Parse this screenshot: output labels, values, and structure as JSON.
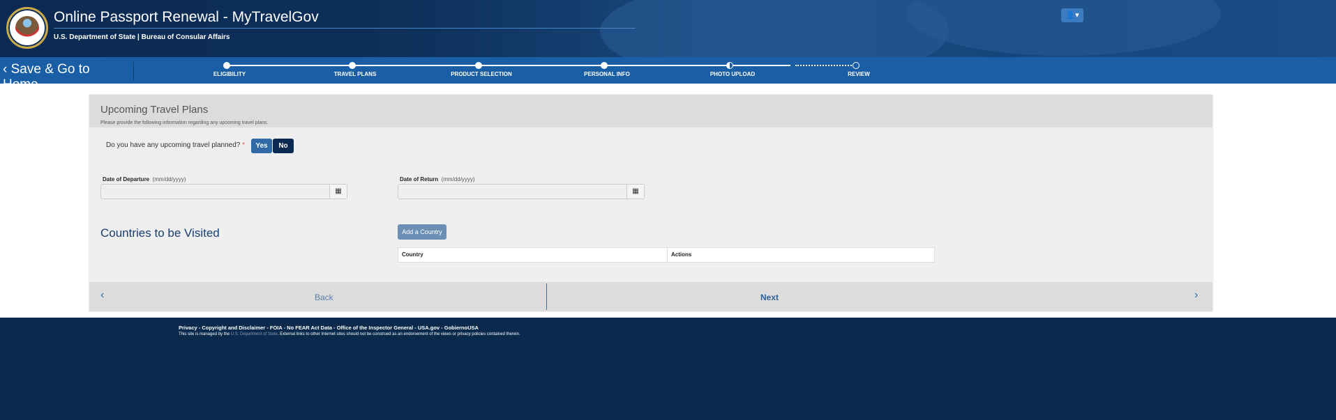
{
  "header": {
    "title": "Online Passport Renewal - MyTravelGov",
    "subtitle": "U.S. Department of State | Bureau of Consular Affairs",
    "user_menu": "👤▾"
  },
  "nav": {
    "save_home": "‹  Save & Go to Home",
    "steps": [
      {
        "label": "ELIGIBILITY",
        "state": "complete"
      },
      {
        "label": "TRAVEL PLANS",
        "state": "complete"
      },
      {
        "label": "PRODUCT SELECTION",
        "state": "complete"
      },
      {
        "label": "PERSONAL INFO",
        "state": "complete"
      },
      {
        "label": "PHOTO UPLOAD",
        "state": "current"
      },
      {
        "label": "REVIEW",
        "state": "pending"
      }
    ]
  },
  "form": {
    "title": "Upcoming Travel Plans",
    "description": "Please provide the following information regarding any upcoming travel plans.",
    "question": "Do you have any upcoming travel planned?",
    "required_mark": "*",
    "yes": "Yes",
    "no": "No",
    "departure_label": "Date of Departure",
    "return_label": "Date of Return",
    "date_hint": "(mm/dd/yyyy)",
    "departure_value": "",
    "return_value": "",
    "countries_title": "Countries to be Visited",
    "add_country": "Add a Country",
    "table_headers": [
      "Country",
      "Actions"
    ]
  },
  "bottom_nav": {
    "back": "Back",
    "next": "Next",
    "prev_icon": "‹",
    "next_icon": "›"
  },
  "footer": {
    "links": "Privacy  -  Copyright and Disclaimer  -  FOIA  -  No FEAR Act Data  -  Office of the Inspector General  -  USA.gov  -  GobiernoUSA",
    "managed_prefix": "This site is managed by the ",
    "managed_dept": "U.S. Department of State",
    "managed_suffix": ". External links to other Internet sites should not be construed as an endorsement of the views or privacy policies contained therein."
  },
  "colors": {
    "header": "#0b2a52",
    "nav": "#1a5fa6",
    "footer": "#0a2a4d",
    "no_selected": "#0b2a52",
    "yes": "#2f6aa6"
  }
}
